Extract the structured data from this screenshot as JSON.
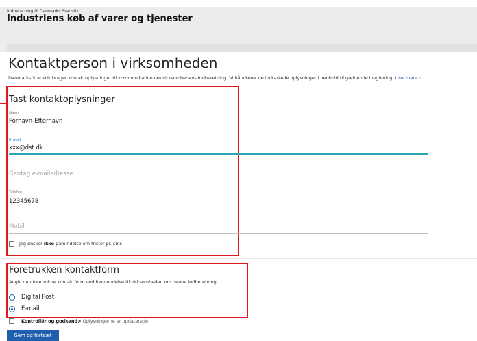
{
  "header": {
    "overline": "Indberetning til Danmarks Statistik",
    "title": "Industriens køb af varer og tjenester"
  },
  "page": {
    "title": "Kontaktperson i virksomheden",
    "intro": "Danmarks Statistik bruger kontaktoplysninger til kommunikation om virksomhedens indberetning. Vi håndterer de indtastede oplysninger i henhold til gældende lovgivning.",
    "read_more": "Læs mere h"
  },
  "contact": {
    "title": "Tast kontaktoplysninger",
    "name": {
      "label": "Navn",
      "value": "Fornavn-Efternavn"
    },
    "email": {
      "label": "E-mail",
      "value": "xxx@dst.dk"
    },
    "email_repeat": {
      "placeholder": "Gentag e-mailadresse"
    },
    "phone": {
      "label": "Telefon",
      "value": "12345678"
    },
    "mobile": {
      "placeholder": "Mobil"
    },
    "sms_optout": {
      "prefix": "Jeg ønsker",
      "bold": "ikke",
      "suffix": "påmindelse om frister pr. sms",
      "checked": false
    }
  },
  "preferred": {
    "title": "Foretrukken kontaktform",
    "description": "Angiv den foretrukne kontaktform ved henvendelse til virksomheden om denne indberetning",
    "options": [
      {
        "label": "Digital Post",
        "selected": false
      },
      {
        "label": "E-mail",
        "selected": true
      }
    ]
  },
  "confirm": {
    "label": "Kontrollér og godkend>",
    "status": "Oplysningerne er opdaterede",
    "checked": false
  },
  "actions": {
    "save_label": "Gem og fortsæt"
  },
  "colors": {
    "accent": "#1f5fae",
    "focus": "#2aa7b4",
    "highlight": "#e0161b"
  }
}
